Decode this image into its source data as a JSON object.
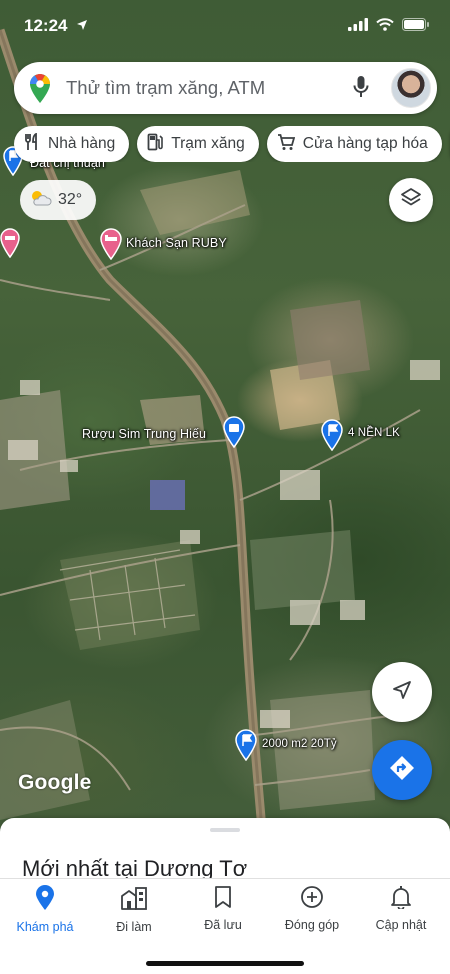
{
  "status_bar": {
    "time": "12:24"
  },
  "search": {
    "placeholder": "Thử tìm trạm xăng, ATM"
  },
  "chips": [
    {
      "label": "Nhà hàng",
      "icon": "fork-knife-icon"
    },
    {
      "label": "Trạm xăng",
      "icon": "gas-pump-icon"
    },
    {
      "label": "Cửa hàng tạp hóa",
      "icon": "shopping-cart-icon"
    }
  ],
  "weather": {
    "temperature": "32°",
    "icon": "sun-cloud-icon"
  },
  "map": {
    "places": [
      {
        "label": "Đất chị thuận"
      },
      {
        "label": "Khách Sạn RUBY"
      },
      {
        "label": "Rượu Sim Trung Hiếu"
      },
      {
        "label": "4 NỀN LK"
      },
      {
        "label": "2000 m2 20Tỷ"
      }
    ],
    "attribution": "Google"
  },
  "sheet": {
    "title": "Mới nhất tại Dương Tơ"
  },
  "nav": {
    "items": [
      {
        "label": "Khám phá",
        "icon": "location-pin-icon",
        "active": true
      },
      {
        "label": "Đi làm",
        "icon": "commute-building-icon",
        "active": false
      },
      {
        "label": "Đã lưu",
        "icon": "bookmark-icon",
        "active": false
      },
      {
        "label": "Đóng góp",
        "icon": "add-circle-icon",
        "active": false
      },
      {
        "label": "Cập nhật",
        "icon": "bell-icon",
        "active": false
      }
    ]
  },
  "colors": {
    "accent": "#1a73e8",
    "pin_blue": "#1a73e8",
    "pin_pink": "#e8618c",
    "road": "#9a8a6c"
  }
}
